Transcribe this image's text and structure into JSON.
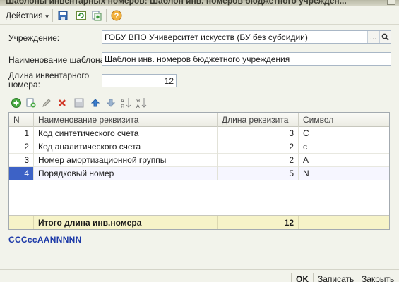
{
  "window": {
    "title": "Шаблоны инвентарных номеров: Шаблон инв. номеров бюджетного учрежден..."
  },
  "toolbar": {
    "actions_label": "Действия",
    "icons": [
      "save-icon",
      "refresh-icon",
      "copy-icon",
      "help-icon"
    ]
  },
  "form": {
    "institution_label": "Учреждение:",
    "institution_value": "ГОБУ ВПО Университет искусств (БУ без субсидии)",
    "template_name_label": "Наименование шаблона:",
    "template_name_value": "Шаблон инв. номеров бюджетного учреждения",
    "length_label_line1": "Длина инвентарного",
    "length_label_line2": "номера:",
    "length_value": "12",
    "select_button": "...",
    "open_button": "search-icon"
  },
  "table": {
    "icons": [
      "add-icon",
      "copy-row-icon",
      "edit-icon",
      "delete-icon",
      "end-edit-icon",
      "move-up-icon",
      "move-down-icon",
      "sort-asc-icon",
      "sort-desc-icon"
    ],
    "columns": [
      "N",
      "Наименование реквизита",
      "Длина реквизита",
      "Символ"
    ],
    "rows": [
      {
        "n": "1",
        "name": "Код синтетического счета",
        "length": "3",
        "symbol": "C"
      },
      {
        "n": "2",
        "name": "Код аналитического счета",
        "length": "2",
        "symbol": "c"
      },
      {
        "n": "3",
        "name": "Номер амортизационной группы",
        "length": "2",
        "symbol": "A"
      },
      {
        "n": "4",
        "name": "Порядковый номер",
        "length": "5",
        "symbol": "N"
      }
    ],
    "selected_row": 4,
    "footer_label": "Итого длина инв.номера",
    "footer_total": "12"
  },
  "pattern_text": "CCCccAANNNNN",
  "buttons": {
    "ok": "OK",
    "save": "Записать",
    "close": "Закрыть"
  },
  "colors": {
    "selection": "#3d62c6",
    "pattern": "#1d3aa8",
    "footer_bg": "#f6f3c8"
  }
}
